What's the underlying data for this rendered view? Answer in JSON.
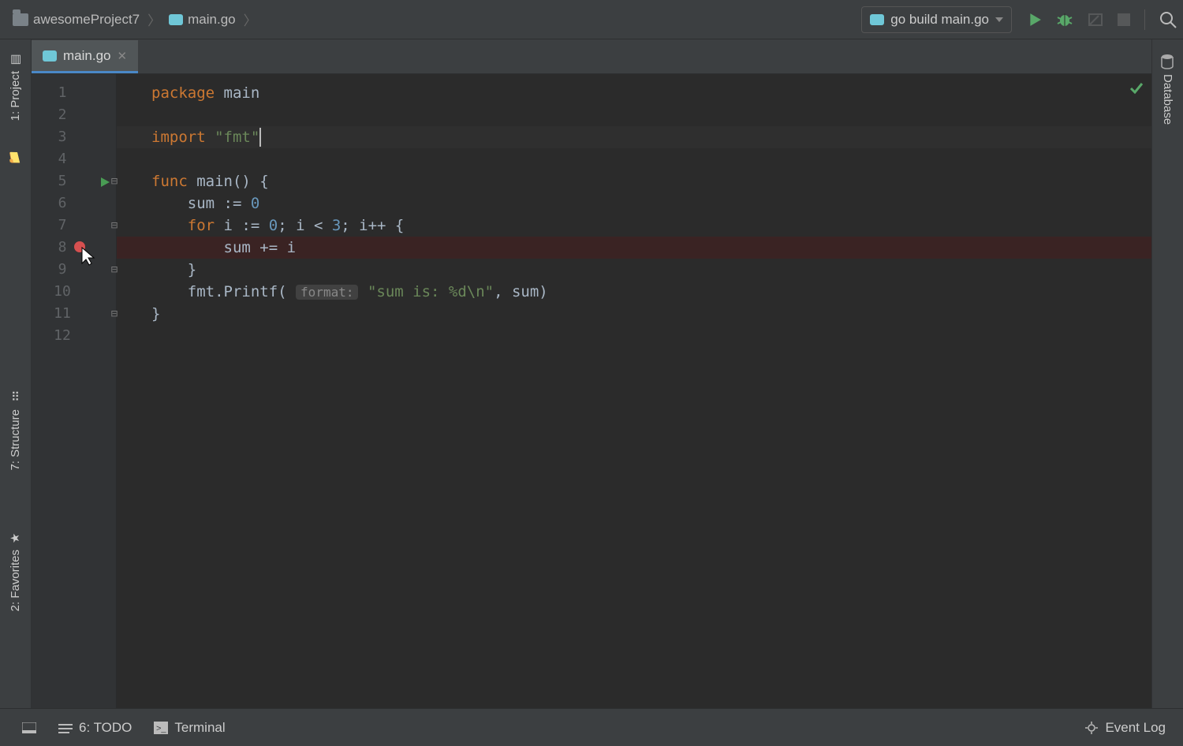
{
  "breadcrumb": {
    "project": "awesomeProject7",
    "file": "main.go"
  },
  "runConfig": {
    "label": "go build main.go"
  },
  "tabs": {
    "active": "main.go"
  },
  "leftTools": {
    "project": "1: Project",
    "structure": "7: Structure",
    "favorites": "2: Favorites"
  },
  "rightTools": {
    "database": "Database"
  },
  "bottom": {
    "todo": "6: TODO",
    "terminal": "Terminal",
    "eventLog": "Event Log"
  },
  "editor": {
    "breakpointLine": 8,
    "lines": [
      {
        "n": 1,
        "tokens": [
          {
            "t": "package",
            "c": "kw"
          },
          {
            "t": " "
          },
          {
            "t": "main",
            "c": "ident"
          }
        ]
      },
      {
        "n": 2,
        "tokens": []
      },
      {
        "n": 3,
        "tokens": [
          {
            "t": "import",
            "c": "kw"
          },
          {
            "t": " "
          },
          {
            "t": "\"fmt\"",
            "c": "str"
          }
        ],
        "caretAfter": true
      },
      {
        "n": 4,
        "tokens": []
      },
      {
        "n": 5,
        "tokens": [
          {
            "t": "func",
            "c": "kw"
          },
          {
            "t": " "
          },
          {
            "t": "main",
            "c": "fn"
          },
          {
            "t": "() {",
            "c": "ident"
          }
        ],
        "run": true,
        "foldOpen": true
      },
      {
        "n": 6,
        "tokens": [
          {
            "t": "    "
          },
          {
            "t": "sum := ",
            "c": "ident"
          },
          {
            "t": "0",
            "c": "num"
          }
        ]
      },
      {
        "n": 7,
        "tokens": [
          {
            "t": "    "
          },
          {
            "t": "for",
            "c": "kw"
          },
          {
            "t": " i := ",
            "c": "ident"
          },
          {
            "t": "0",
            "c": "num"
          },
          {
            "t": "; i < ",
            "c": "ident"
          },
          {
            "t": "3",
            "c": "num"
          },
          {
            "t": "; i++ {",
            "c": "ident"
          }
        ],
        "foldOpen": true
      },
      {
        "n": 8,
        "tokens": [
          {
            "t": "        "
          },
          {
            "t": "sum += i",
            "c": "ident"
          }
        ],
        "breakpoint": true
      },
      {
        "n": 9,
        "tokens": [
          {
            "t": "    }",
            "c": "ident"
          }
        ],
        "foldClose": true
      },
      {
        "n": 10,
        "tokens": [
          {
            "t": "    "
          },
          {
            "t": "fmt.Printf( ",
            "c": "ident"
          },
          {
            "hint": "format:"
          },
          {
            "t": " "
          },
          {
            "t": "\"sum is: %d\\n\"",
            "c": "str"
          },
          {
            "t": ", sum)",
            "c": "ident"
          }
        ]
      },
      {
        "n": 11,
        "tokens": [
          {
            "t": "}",
            "c": "ident"
          }
        ],
        "foldClose": true
      },
      {
        "n": 12,
        "tokens": []
      }
    ]
  }
}
